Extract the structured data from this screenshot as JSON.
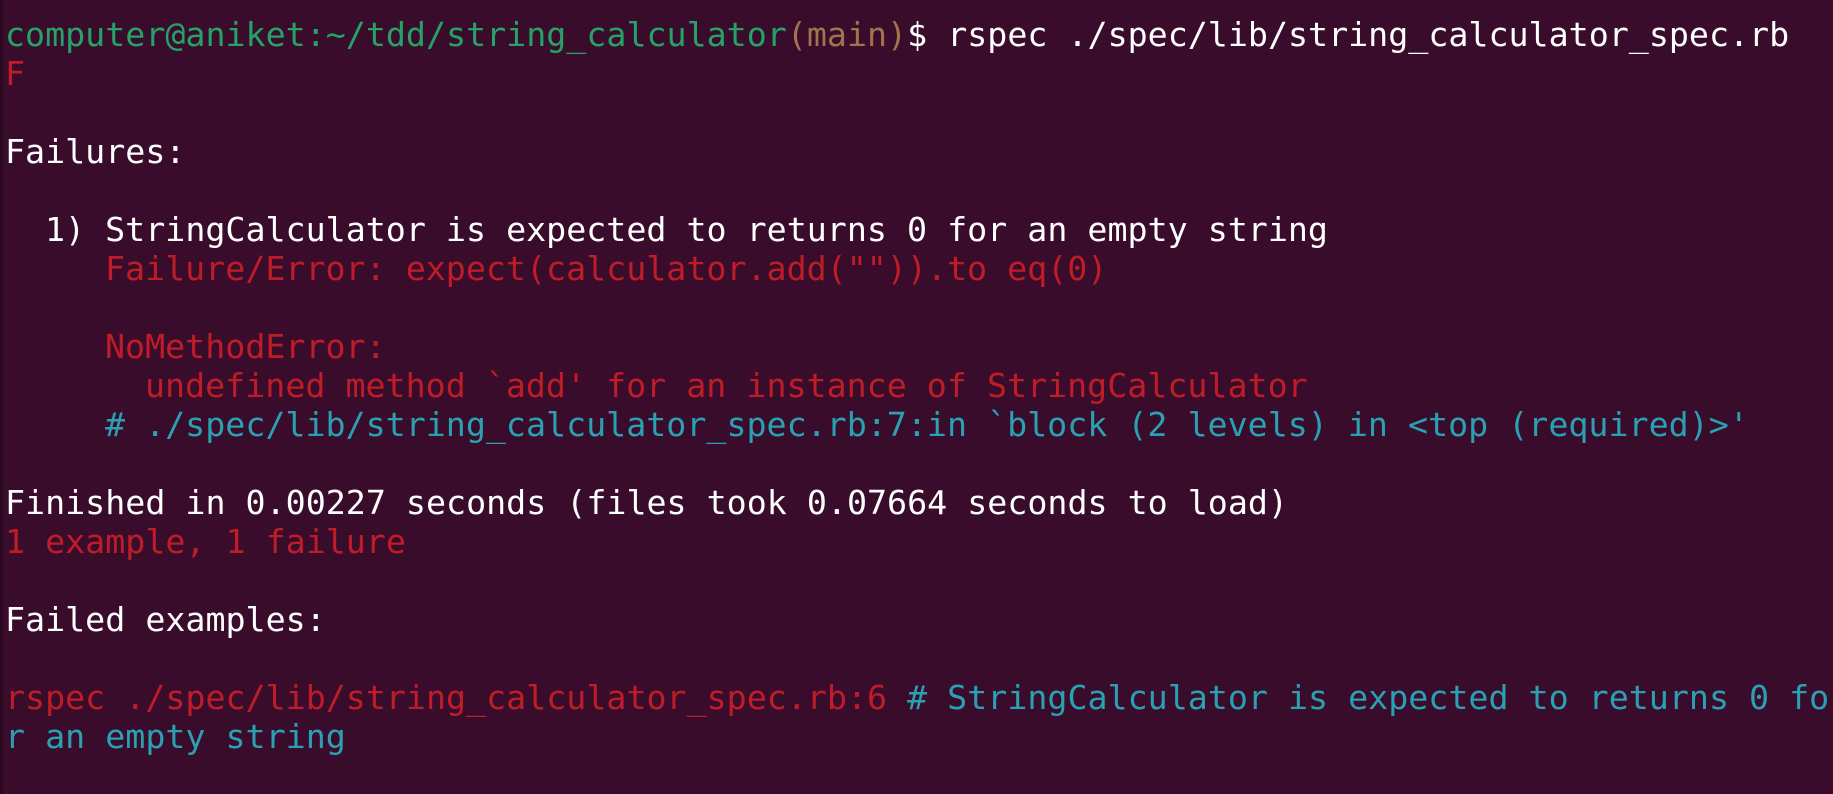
{
  "prompt": {
    "user_host": "computer@aniket",
    "path": ":~/tdd/string_calculator",
    "branch": "(main)",
    "symbol": "$ ",
    "command": "rspec ./spec/lib/string_calculator_spec.rb"
  },
  "progress": "F",
  "failures_header": "Failures:",
  "failure": {
    "title": "1) StringCalculator is expected to returns 0 for an empty string",
    "error_line": "Failure/Error: expect(calculator.add(\"\")).to eq(0)",
    "error_class": "NoMethodError:",
    "error_message": "undefined method `add' for an instance of StringCalculator",
    "backtrace": "# ./spec/lib/string_calculator_spec.rb:7:in `block (2 levels) in <top (required)>'"
  },
  "summary": {
    "finished": "Finished in 0.00227 seconds (files took 0.07664 seconds to load)",
    "result": "1 example, 1 failure"
  },
  "failed_examples_header": "Failed examples:",
  "rerun": {
    "command": "rspec ./spec/lib/string_calculator_spec.rb:6",
    "comment_line1": " # StringCalculator is expected to returns 0 fo",
    "comment_line2": "r an empty string"
  },
  "colors": {
    "background": "#380c2a",
    "prompt_green": "#26a269",
    "branch_brown": "#a2734c",
    "error_red": "#c01c28",
    "comment_cyan": "#2aa1b3",
    "text_white": "#ffffff"
  }
}
